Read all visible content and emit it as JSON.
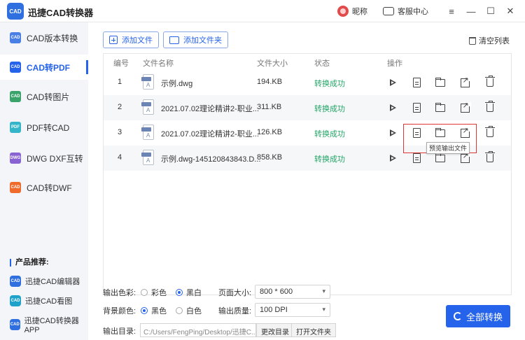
{
  "app": {
    "logo_text": "CAD",
    "title": "迅捷CAD转换器"
  },
  "titlebar": {
    "nickname": "昵称",
    "support": "客服中心",
    "min": "—",
    "max": "☐",
    "close": "✕"
  },
  "sidebar": {
    "items": [
      {
        "label": "CAD版本转换",
        "icon_text": "CAD",
        "color": "#4a7fe6"
      },
      {
        "label": "CAD转PDF",
        "icon_text": "CAD",
        "color": "#2563eb"
      },
      {
        "label": "CAD转图片",
        "icon_text": "CAD",
        "color": "#3aa36a"
      },
      {
        "label": "PDF转CAD",
        "icon_text": "PDF",
        "color": "#35b5c9"
      },
      {
        "label": "DWG DXF互转",
        "icon_text": "DWG",
        "color": "#8a63d2"
      },
      {
        "label": "CAD转DWF",
        "icon_text": "CAD",
        "color": "#ef6a2b"
      }
    ],
    "recommend_title": "产品推荐:",
    "recommend": [
      {
        "label": "迅捷CAD编辑器",
        "icon_text": "CAD",
        "color": "#2f6fe0"
      },
      {
        "label": "迅捷CAD看图",
        "icon_text": "CAD",
        "color": "#1fa2c9"
      },
      {
        "label": "迅捷CAD转换器APP",
        "icon_text": "CAD",
        "color": "#2f6fe0"
      }
    ]
  },
  "toolbar": {
    "add_file": "添加文件",
    "add_folder": "添加文件夹",
    "clear_list": "清空列表"
  },
  "table": {
    "headers": {
      "num": "编号",
      "name": "文件名称",
      "size": "文件大小",
      "status": "状态",
      "ops": "操作"
    },
    "rows": [
      {
        "num": "1",
        "name": "示例.dwg",
        "size": "194.KB",
        "status": "转换成功"
      },
      {
        "num": "2",
        "name": "2021.07.02理论精讲2-职业...",
        "size": "311.KB",
        "status": "转换成功"
      },
      {
        "num": "3",
        "name": "2021.07.02理论精讲2-职业...",
        "size": "126.KB",
        "status": "转换成功"
      },
      {
        "num": "4",
        "name": "示例.dwg-145120843843.D...",
        "size": "858.KB",
        "status": "转换成功"
      }
    ],
    "tooltip": "预览输出文件"
  },
  "settings": {
    "color_label": "输出色彩:",
    "color_options": [
      "彩色",
      "黑白"
    ],
    "color_selected": 1,
    "bg_label": "背景颜色:",
    "bg_options": [
      "黑色",
      "白色"
    ],
    "bg_selected": 0,
    "page_size_label": "页面大小:",
    "page_size_value": "800 * 600",
    "quality_label": "输出质量:",
    "quality_value": "100 DPI",
    "dir_label": "输出目录:",
    "dir_value": "C:/Users/FengPing/Desktop/迅捷C...",
    "change_dir": "更改目录",
    "open_folder": "打开文件夹",
    "convert_all": "全部转换"
  },
  "colors": {
    "accent": "#2563eb",
    "success": "#23a566",
    "highlight": "#e03535"
  }
}
